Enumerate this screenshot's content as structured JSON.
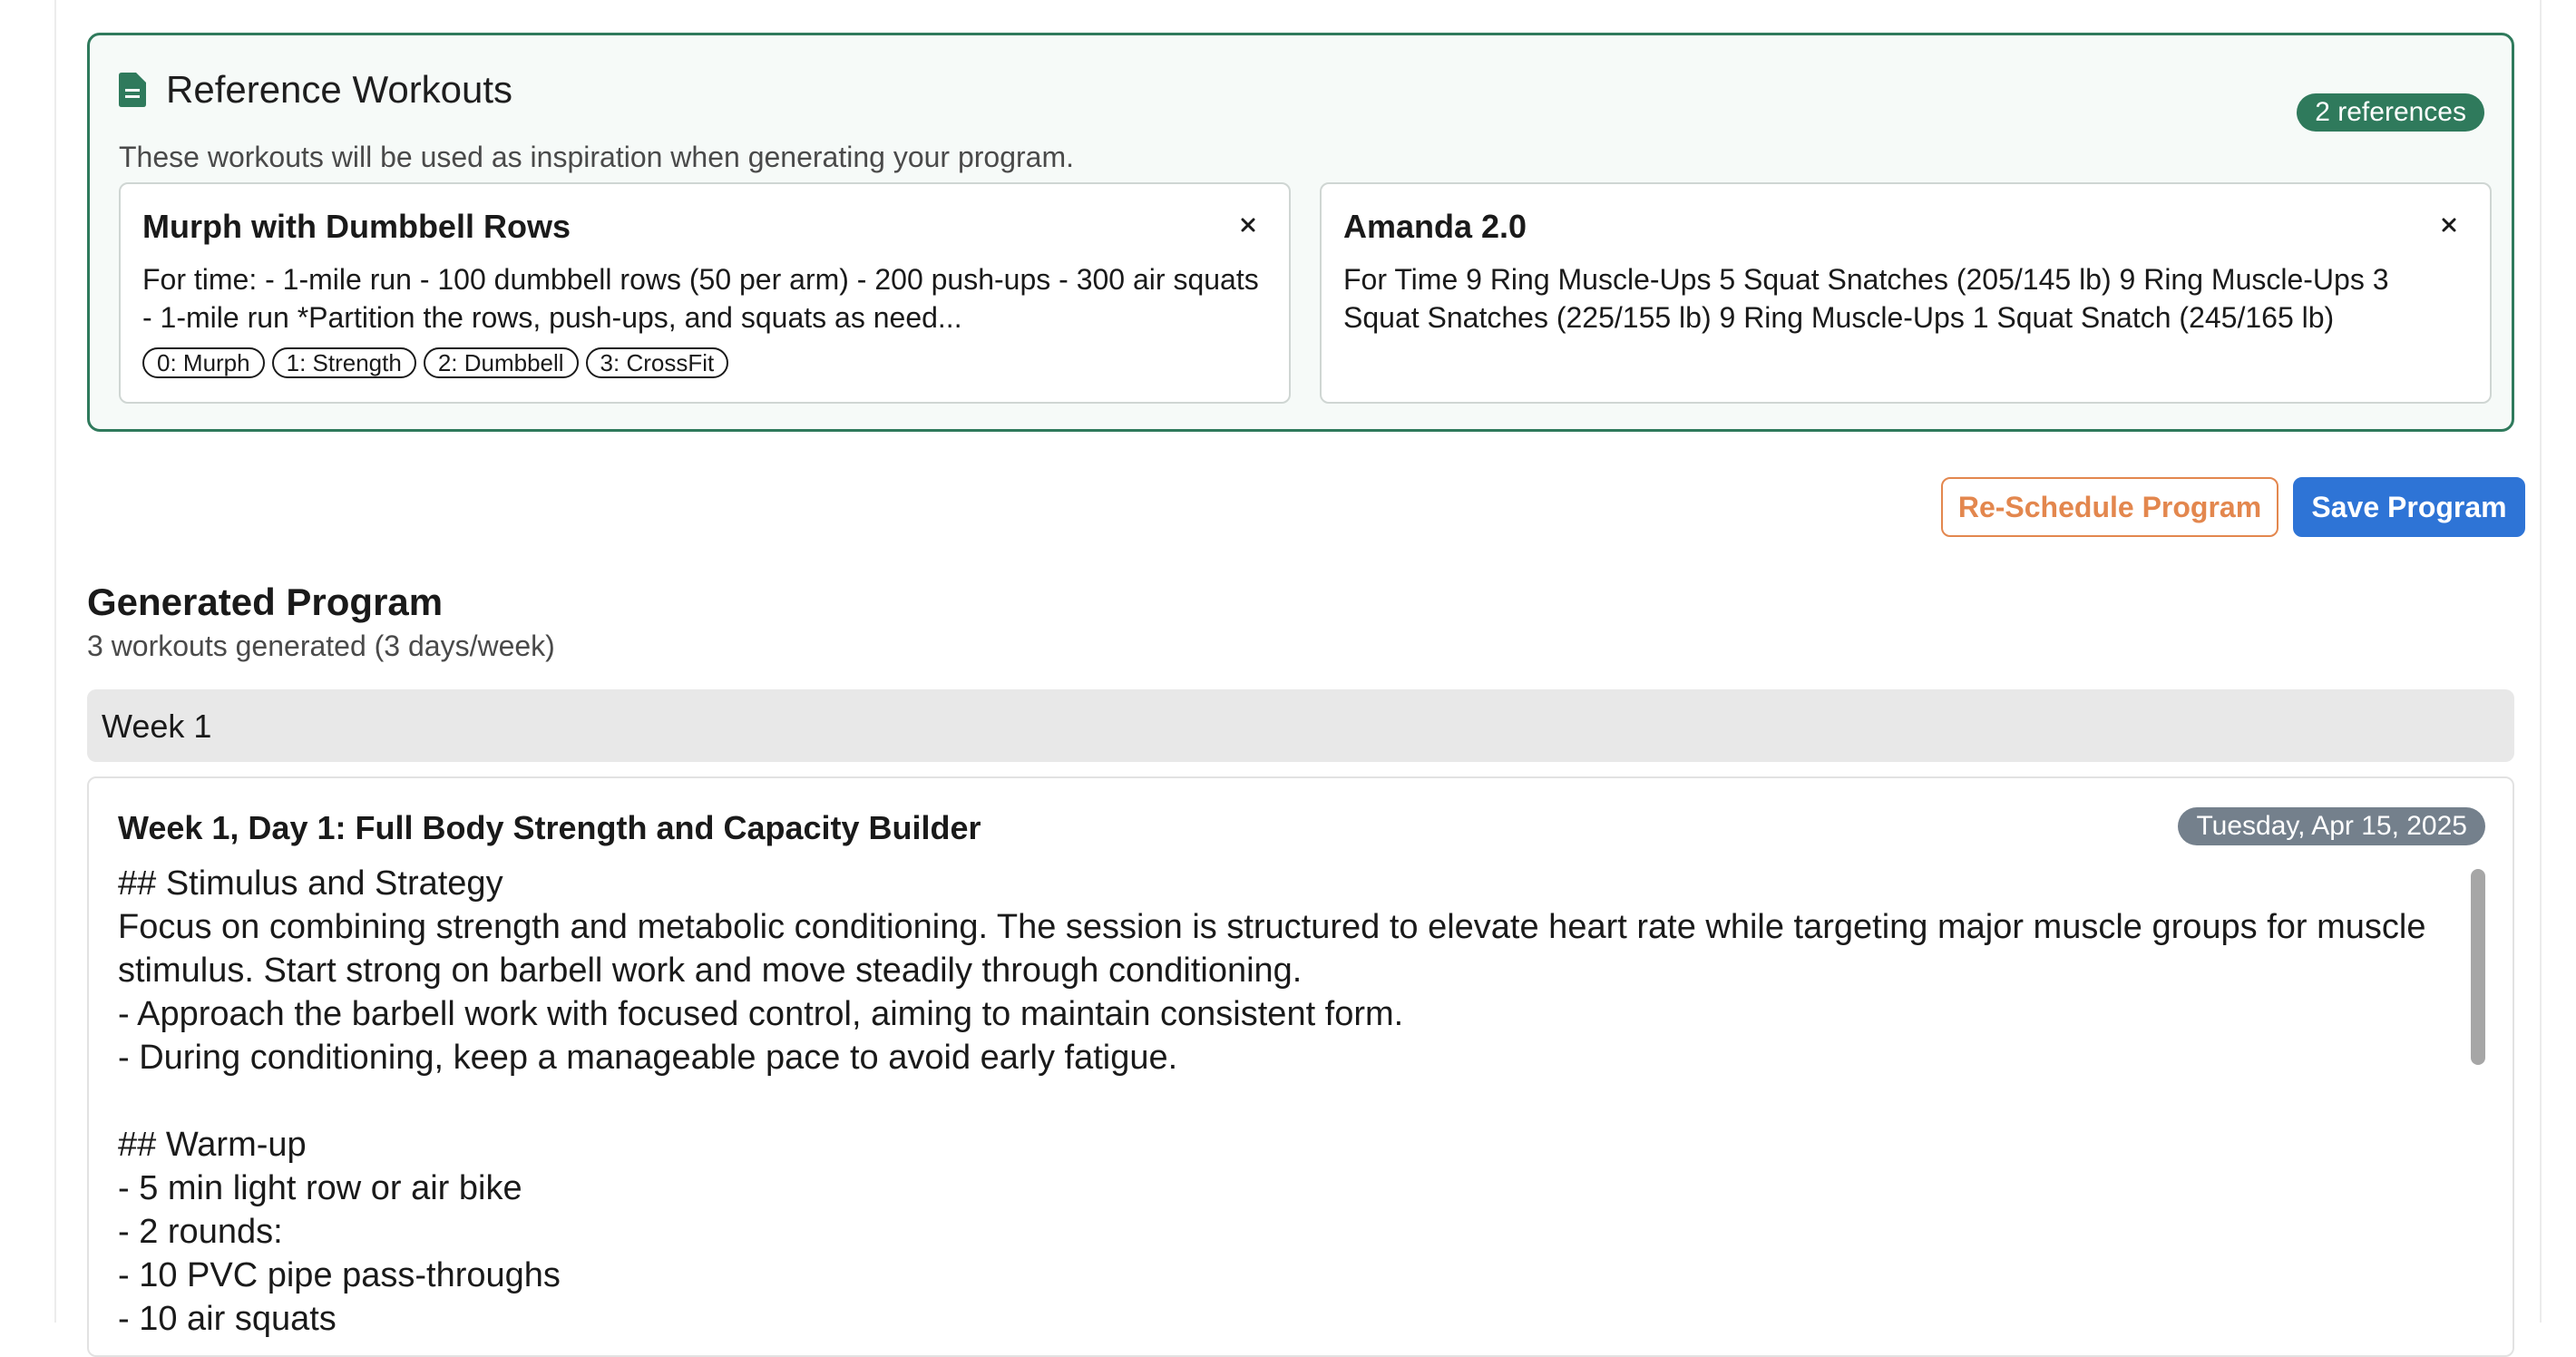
{
  "reference": {
    "title": "Reference Workouts",
    "subtitle": "These workouts will be used as inspiration when generating your program.",
    "badge": "2 references",
    "icon": "document-icon",
    "accent_color": "#2f7a5c",
    "items": [
      {
        "title": "Murph with Dumbbell Rows",
        "description": "For time: - 1-mile run - 100 dumbbell rows (50 per arm) - 200 push-ups - 300 air squats - 1-mile run *Partition the rows, push-ups, and squats as need...",
        "tags": [
          "0: Murph",
          "1: Strength",
          "2: Dumbbell",
          "3: CrossFit"
        ],
        "close_icon": "close-icon"
      },
      {
        "title": "Amanda 2.0",
        "description": "For Time 9 Ring Muscle-Ups 5 Squat Snatches (205/145 lb) 9 Ring Muscle-Ups 3 Squat Snatches (225/155 lb) 9 Ring Muscle-Ups 1 Squat Snatch (245/165 lb)",
        "tags": [],
        "close_icon": "close-icon"
      }
    ]
  },
  "actions": {
    "reschedule_label": "Re-Schedule Program",
    "save_label": "Save Program",
    "reschedule_color": "#e3874e",
    "save_color": "#2e74d6"
  },
  "program": {
    "title": "Generated Program",
    "subtitle": "3 workouts generated (3 days/week)",
    "week_label": "Week 1",
    "workout": {
      "title": "Week 1, Day 1: Full Body Strength and Capacity Builder",
      "date": "Tuesday, Apr 15, 2025",
      "body": "## Stimulus and Strategy\nFocus on combining strength and metabolic conditioning. The session is structured to elevate heart rate while targeting major muscle groups for muscle stimulus. Start strong on barbell work and move steadily through conditioning.\n- Approach the barbell work with focused control, aiming to maintain consistent form.\n- During conditioning, keep a manageable pace to avoid early fatigue.\n\n## Warm-up\n- 5 min light row or air bike\n- 2 rounds:\n- 10 PVC pipe pass-throughs\n- 10 air squats"
    }
  }
}
